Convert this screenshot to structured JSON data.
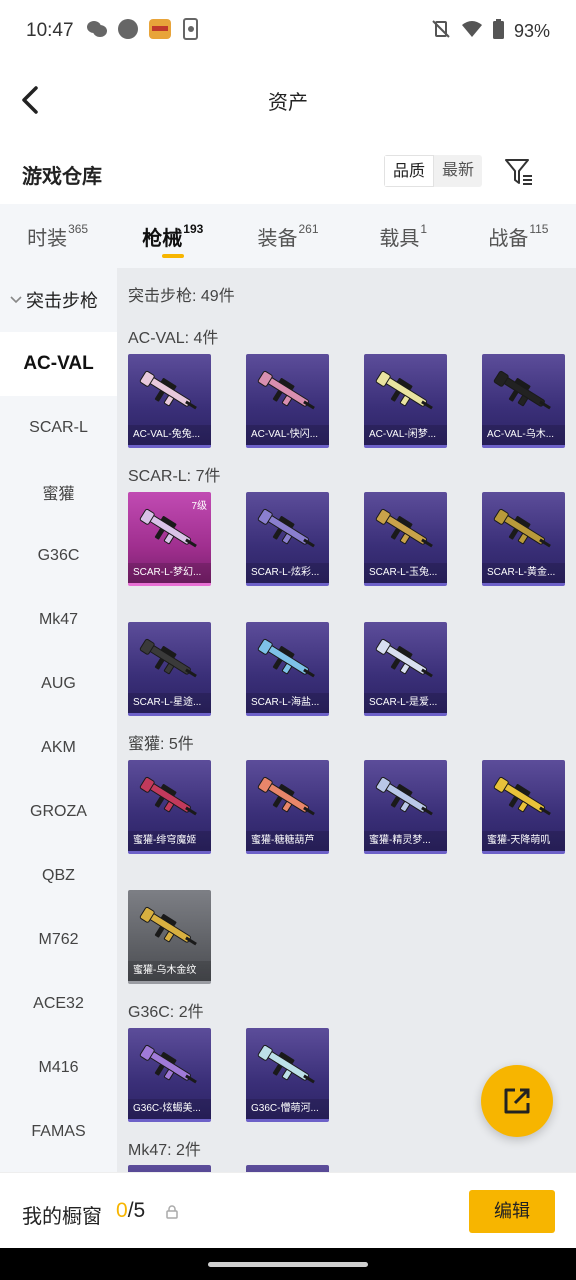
{
  "status_bar": {
    "time": "10:47",
    "battery": "93%"
  },
  "header": {
    "title": "资产"
  },
  "warehouse": {
    "title": "游戏仓库",
    "sort_options": [
      "品质",
      "最新"
    ]
  },
  "tabs": [
    {
      "label": "时装",
      "count": "365"
    },
    {
      "label": "枪械",
      "count": "193"
    },
    {
      "label": "装备",
      "count": "261"
    },
    {
      "label": "载具",
      "count": "1"
    },
    {
      "label": "战备",
      "count": "115"
    }
  ],
  "sidebar": {
    "category": "突击步枪",
    "items": [
      "AC-VAL",
      "SCAR-L",
      "蜜獾",
      "G36C",
      "Mk47",
      "AUG",
      "AKM",
      "GROZA",
      "QBZ",
      "M762",
      "ACE32",
      "M416",
      "FAMAS"
    ]
  },
  "content": {
    "category_header": "突击步枪: 49件",
    "sections": [
      {
        "header": "AC-VAL: 4件",
        "cards": [
          "AC-VAL-兔兔...",
          "AC-VAL-快闪...",
          "AC-VAL-闲梦...",
          "AC-VAL-乌木..."
        ]
      },
      {
        "header": "SCAR-L: 7件",
        "level": "7级",
        "cards": [
          "SCAR-L-梦幻...",
          "SCAR-L-炫彩...",
          "SCAR-L-玉兔...",
          "SCAR-L-黄金...",
          "SCAR-L-星途...",
          "SCAR-L-海盐...",
          "SCAR-L-是爱..."
        ]
      },
      {
        "header": "蜜獾: 5件",
        "cards": [
          "蜜獾-绯穹魔姬",
          "蜜獾-糖糖葫芦",
          "蜜獾-精灵梦...",
          "蜜獾-天降萌叽",
          "蜜獾-乌木金纹"
        ]
      },
      {
        "header": "G36C: 2件",
        "cards": [
          "G36C-炫蝎美...",
          "G36C-懵萌河..."
        ]
      },
      {
        "header": "Mk47: 2件"
      }
    ]
  },
  "bottom": {
    "label": "我的橱窗",
    "current": "0",
    "total": "/5",
    "edit_label": "编辑"
  },
  "colors": {
    "accent": "#f7b500",
    "card_purple": "#3a2f78",
    "card_pink": "#a02f8f",
    "card_gray": "#5f6166"
  }
}
